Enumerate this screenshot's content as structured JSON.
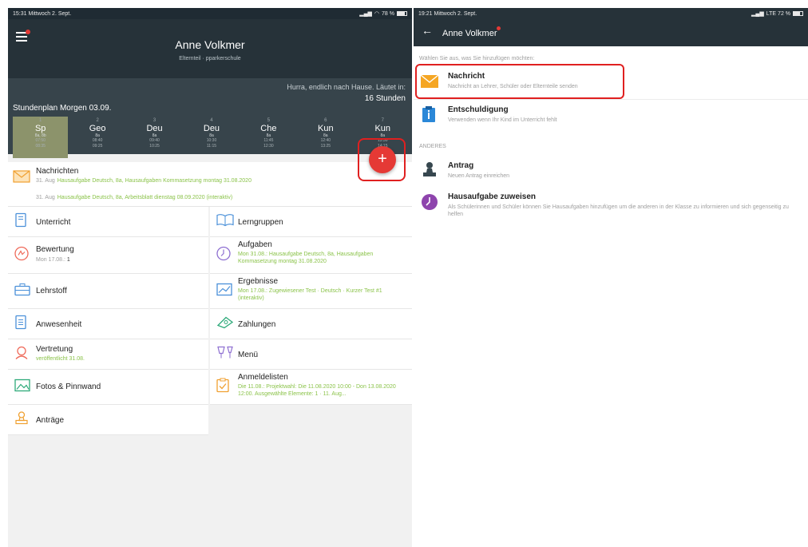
{
  "left": {
    "status": {
      "time": "15:31",
      "date": "Mittwoch 2. Sept.",
      "battery": "78 %",
      "battery_level": 0.78
    },
    "header": {
      "name": "Anne Volkmer",
      "role": "Elternteil · pparkerschule"
    },
    "schedule": {
      "message": "Hurra, endlich nach Hause. Läutet in:",
      "countdown": "16 Stunden",
      "title": "Stundenplan Morgen 03.09.",
      "periods": [
        {
          "num": "1",
          "subject": "Sp",
          "class": "8a, 8b",
          "start": "07:50",
          "end": "08:35"
        },
        {
          "num": "2",
          "subject": "Geo",
          "class": "8a",
          "start": "08:40",
          "end": "09:25"
        },
        {
          "num": "3",
          "subject": "Deu",
          "class": "8a",
          "start": "09:40",
          "end": "10:25"
        },
        {
          "num": "4",
          "subject": "Deu",
          "class": "8a",
          "start": "10:30",
          "end": "11:15"
        },
        {
          "num": "5",
          "subject": "Che",
          "class": "8a",
          "start": "11:45",
          "end": "12:30"
        },
        {
          "num": "6",
          "subject": "Kun",
          "class": "8a",
          "start": "12:40",
          "end": "13:25"
        },
        {
          "num": "7",
          "subject": "Kun",
          "class": "8a",
          "start": "13:30",
          "end": "14:15"
        }
      ]
    },
    "fab_label": "+",
    "news": {
      "title": "Nachrichten",
      "lines": [
        {
          "date": "31. Aug",
          "text": "Hausaufgabe Deutsch, 8a, Hausaufgaben Kommasetzung montag 31.08.2020"
        },
        {
          "date": "31. Aug",
          "text": "Hausaufgabe Deutsch, 8a, Arbeitsblatt dienstag 08.09.2020 (interaktiv)"
        }
      ]
    },
    "tiles": {
      "unterricht": {
        "title": "Unterricht"
      },
      "lerngruppen": {
        "title": "Lerngruppen"
      },
      "bewertung": {
        "title": "Bewertung",
        "sub": "Mon 17.08.:",
        "value": "1"
      },
      "aufgaben": {
        "title": "Aufgaben",
        "sub": "Mon 31.08.: Hausaufgabe Deutsch, 8a, Hausaufgaben Kommasetzung montag 31.08.2020"
      },
      "lehrstoff": {
        "title": "Lehrstoff"
      },
      "ergebnisse": {
        "title": "Ergebnisse",
        "sub": "Mon 17.08.: Zugewiesener Test · Deutsch · Kurzer Test #1 (interaktiv)"
      },
      "anwesenheit": {
        "title": "Anwesenheit"
      },
      "zahlungen": {
        "title": "Zahlungen"
      },
      "vertretung": {
        "title": "Vertretung",
        "sub": "veröffentlicht 31.08."
      },
      "menu": {
        "title": "Menü"
      },
      "fotos": {
        "title": "Fotos & Pinnwand"
      },
      "anmeldelisten": {
        "title": "Anmeldelisten",
        "sub": "Die 11.08.: Projektwahl: Die 11.08.2020 10:00 - Don 13.08.2020 12:00. Ausgewählte Elemente: 1 · 11. Aug..."
      },
      "antraege": {
        "title": "Anträge"
      }
    }
  },
  "right": {
    "status": {
      "time": "19:21",
      "date": "Mittwoch 2. Sept.",
      "network": "LTE 72 %",
      "battery_level": 0.72
    },
    "header": {
      "back": "←",
      "name": "Anne Volkmer"
    },
    "prompt": "Wählen Sie aus, was Sie hinzufügen möchten:",
    "items": [
      {
        "title": "Nachricht",
        "sub": "Nachricht an Lehrer, Schüler oder Elternteile senden"
      },
      {
        "title": "Entschuldigung",
        "sub": "Verwenden wenn Ihr Kind im Unterricht fehlt"
      }
    ],
    "section": "ANDERES",
    "other_items": [
      {
        "title": "Antrag",
        "sub": "Neuen Antrag einreichen"
      },
      {
        "title": "Hausaufgabe zuweisen",
        "sub": "Als Schülerinnen und Schüler können Sie Hausaufgaben hinzufügen um die anderen in der Klasse zu informieren und sich gegenseitig zu helfen"
      }
    ]
  },
  "colors": {
    "header": "#263239",
    "schedule": "#37444b",
    "accent_red": "#e53935",
    "green_text": "#8bc34a",
    "active_period": "#8c936b"
  }
}
